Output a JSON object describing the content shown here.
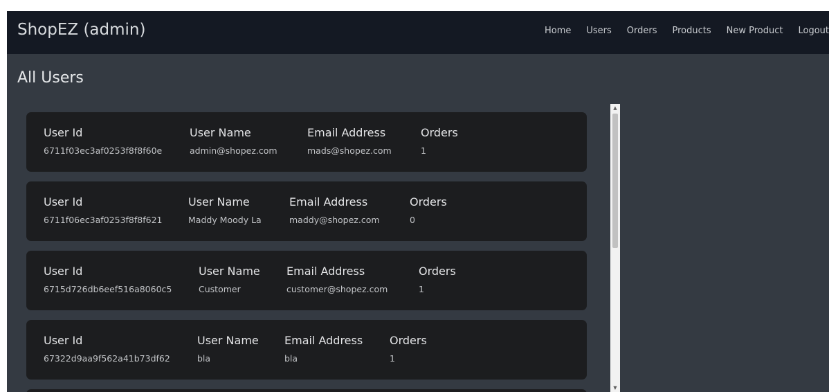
{
  "navbar": {
    "brand": "ShopEZ (admin)",
    "links": [
      "Home",
      "Users",
      "Orders",
      "Products",
      "New Product",
      "Logout"
    ]
  },
  "page_title": "All Users",
  "labels": {
    "user_id": "User Id",
    "user_name": "User Name",
    "email": "Email Address",
    "orders": "Orders"
  },
  "users": [
    {
      "id": "6711f03ec3af0253f8f8f60e",
      "name": "admin@shopez.com",
      "email": "mads@shopez.com",
      "orders": "1"
    },
    {
      "id": "6711f06ec3af0253f8f8f621",
      "name": "Maddy Moody La",
      "email": "maddy@shopez.com",
      "orders": "0"
    },
    {
      "id": "6715d726db6eef516a8060c5",
      "name": "Customer",
      "email": "customer@shopez.com",
      "orders": "1"
    },
    {
      "id": "67322d9aa9f562a41b73df62",
      "name": "bla",
      "email": "bla",
      "orders": "1"
    }
  ],
  "scroll": {
    "position": 0.0,
    "visible_fraction": 0.5
  },
  "colors": {
    "navbar_bg": "#141923",
    "page_bg": "#343a42",
    "card_bg": "#1c1d1f",
    "text": "#dcdde0"
  }
}
